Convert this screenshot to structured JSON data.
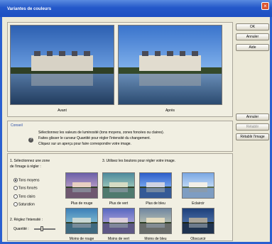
{
  "window": {
    "title": "Variantes de couleurs"
  },
  "buttons": {
    "ok": "OK",
    "cancel_top": "Annuler",
    "help": "Aide",
    "cancel_mid": "Annuler",
    "reset": "Rétablir",
    "reset_image": "Rétablir l'image"
  },
  "preview": {
    "before": "Avant",
    "after": "Après"
  },
  "conseil": {
    "label": "Conseil",
    "line1": "Sélectionnez les valeurs de luminosité (tons moyens, zones foncées ou claires).",
    "line2": "Faites glisser le curseur Quantité pour régler l'intensité du changement.",
    "line3": "Cliquez sur un aperçu pour faire correspondre votre image."
  },
  "step1": {
    "title_line1": "1. Sélectionnez une zone",
    "title_line2": "de l'image à régler :"
  },
  "radios": [
    {
      "label": "Tons moyens",
      "selected": true
    },
    {
      "label": "Tons foncés",
      "selected": false
    },
    {
      "label": "Tons clairs",
      "selected": false
    },
    {
      "label": "Saturation",
      "selected": false
    }
  ],
  "step2": {
    "title": "2. Réglez l'intensité :",
    "quantity_label": "Quantité :",
    "quantity_value": 0.35
  },
  "step3": {
    "title": "3. Utilisez les boutons pour régler votre image."
  },
  "variants": {
    "more_red": "Plus de rouge",
    "more_green": "Plus de vert",
    "more_blue": "Plus de bleu",
    "lighten": "Eclaircir",
    "less_red": "Moins de rouge",
    "less_green": "Moins de vert",
    "less_blue": "Moins de bleu",
    "darken": "Obscurcir"
  },
  "colors": {
    "title_bar": "#2458c9",
    "panel_bg": "#f1efe2",
    "button_border": "#8a8677",
    "sky_before": "#3d74c8",
    "sky_after": "#4f88d6"
  }
}
